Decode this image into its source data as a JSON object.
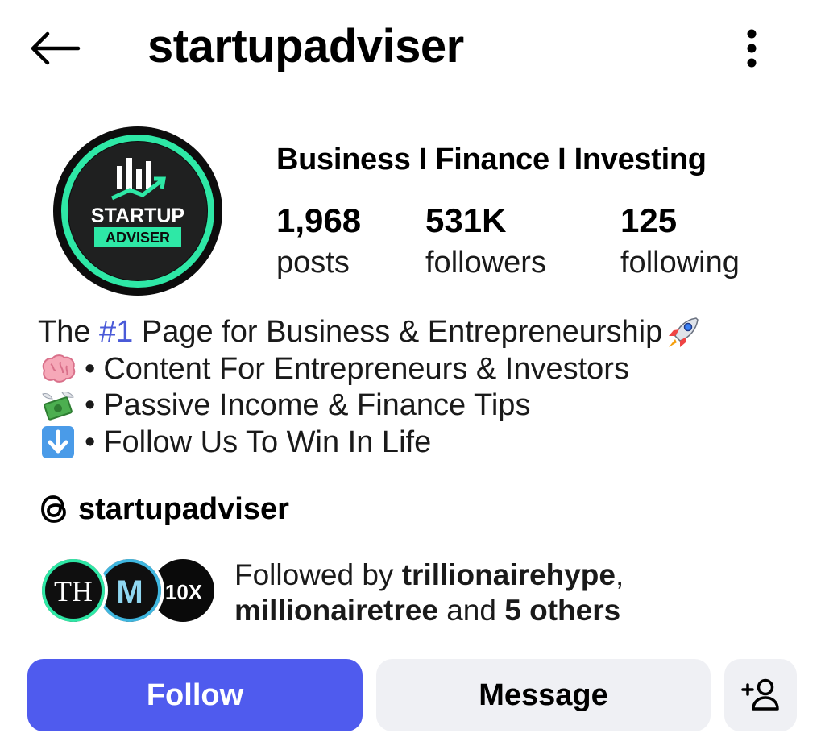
{
  "header": {
    "back_icon": "arrow-left-icon",
    "username": "startupadviser",
    "more_icon": "more-vertical-icon"
  },
  "profile": {
    "avatar": {
      "line1": "STARTUP",
      "line2": "ADVISER",
      "accent_color": "#2ee8a6"
    },
    "category": "Business I Finance I Investing",
    "stats": {
      "posts": {
        "value": "1,968",
        "label": "posts"
      },
      "followers": {
        "value": "531K",
        "label": "followers"
      },
      "following": {
        "value": "125",
        "label": "following"
      }
    }
  },
  "bio": {
    "line1": {
      "before": "The ",
      "hashtag": "#1",
      "after": " Page for Business & Entrepreneurship",
      "emoji": "rocket"
    },
    "line2": {
      "emoji": "brain",
      "bullet": "•",
      "text": "Content For Entrepreneurs & Investors"
    },
    "line3": {
      "emoji": "money-with-wings",
      "bullet": "•",
      "text": "Passive Income & Finance Tips"
    },
    "line4": {
      "emoji": "down-arrow-box",
      "bullet": "•",
      "text": "Follow Us To Win In Life"
    },
    "hashtag_color": "#4a5ad8"
  },
  "threads": {
    "icon": "threads-icon",
    "username": "startupadviser"
  },
  "followed_by": {
    "prefix": "Followed by ",
    "user1": "trillionairehype",
    "comma": ",",
    "user2": "millionairetree",
    "and": " and ",
    "others": "5 others",
    "avatars": [
      {
        "initials": "TH"
      },
      {
        "initials": "M"
      },
      {
        "initials": "10X"
      }
    ]
  },
  "actions": {
    "follow": "Follow",
    "message": "Message",
    "suggest_icon": "add-person-icon",
    "follow_color": "#4f5bee",
    "secondary_bg": "#eff0f4"
  }
}
